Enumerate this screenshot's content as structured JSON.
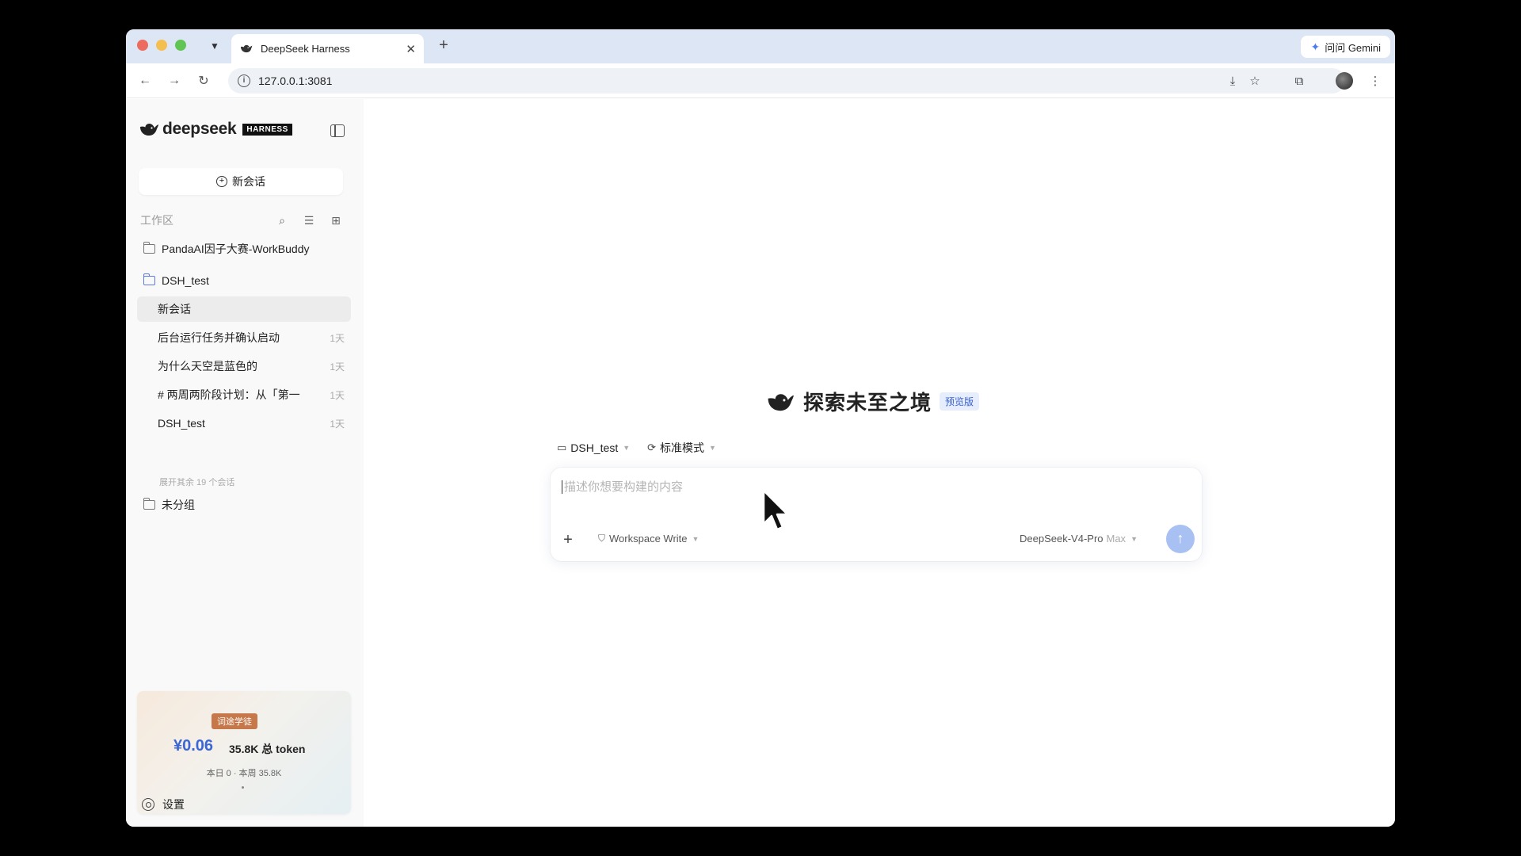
{
  "browser": {
    "tab_title": "DeepSeek Harness",
    "gemini_label": "问问 Gemini",
    "url": "127.0.0.1:3081"
  },
  "sidebar": {
    "logo_text": "deepseek",
    "logo_badge": "HARNESS",
    "new_chat_label": "新会话",
    "workspace_label": "工作区",
    "folders": [
      {
        "name": "PandaAI因子大赛-WorkBuddy"
      },
      {
        "name": "DSH_test"
      },
      {
        "name": "未分组"
      }
    ],
    "sessions": [
      {
        "title": "新会话",
        "time": ""
      },
      {
        "title": "后台运行任务并确认启动",
        "time": "1天"
      },
      {
        "title": "为什么天空是蓝色的",
        "time": "1天"
      },
      {
        "title": "# 两周两阶段计划：从「第一",
        "time": "1天"
      },
      {
        "title": "DSH_test",
        "time": "1天"
      }
    ],
    "expand_more": "展开其余 19 个会话",
    "stats": {
      "tag": "词途学徒",
      "money": "¥0.06",
      "token": "35.8K 总 token",
      "sub": "本日 0 · 本周 35.8K"
    },
    "settings_label": "设置"
  },
  "main": {
    "hero_title": "探索未至之境",
    "hero_badge": "预览版",
    "workspace_selector": "DSH_test",
    "mode_selector": "标准模式",
    "input_placeholder": "描述你想要构建的内容",
    "permission": "Workspace Write",
    "model": "DeepSeek-V4-Pro",
    "model_level": "Max"
  },
  "colors": {
    "accent": "#3b66d6",
    "send_button": "#a9c0f2",
    "tag_bg": "#c6784a"
  }
}
